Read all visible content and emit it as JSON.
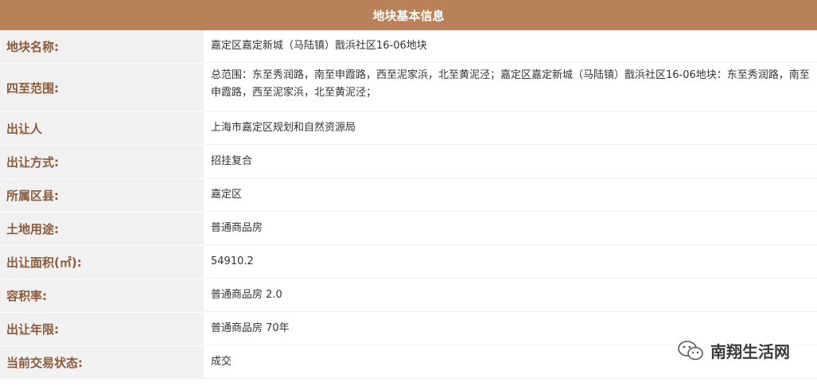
{
  "header": {
    "title": "地块基本信息"
  },
  "rows": [
    {
      "label": "地块名称:",
      "value": "嘉定区嘉定新城（马陆镇）戬浜社区16-06地块"
    },
    {
      "label": "四至范围:",
      "value": "总范围：东至秀润路，南至申霞路，西至泥家浜，北至黄泥泾；嘉定区嘉定新城（马陆镇）戬浜社区16-06地块：东至秀润路，南至申霞路，西至泥家浜，北至黄泥泾；"
    },
    {
      "label": "出让人",
      "value": "上海市嘉定区规划和自然资源局"
    },
    {
      "label": "出让方式:",
      "value": "招挂复合"
    },
    {
      "label": "所属区县:",
      "value": "嘉定区"
    },
    {
      "label": "土地用途:",
      "value": "普通商品房"
    },
    {
      "label": "出让面积(㎡):",
      "value": "54910.2"
    },
    {
      "label": "容积率:",
      "value": "普通商品房 2.0"
    },
    {
      "label": "出让年限:",
      "value": "普通商品房 70年"
    },
    {
      "label": "当前交易状态:",
      "value": "成交"
    }
  ],
  "watermark": {
    "text": "南翔生活网",
    "icon": "wechat-icon"
  }
}
